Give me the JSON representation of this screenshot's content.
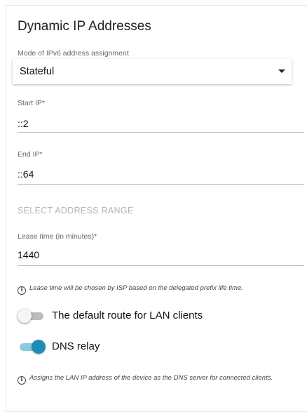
{
  "form": {
    "title": "Dynamic IP Addresses",
    "mode": {
      "label": "Mode of IPv6 address assignment",
      "value": "Stateful"
    },
    "start_ip": {
      "label": "Start IP",
      "required_mark": "*",
      "value": "::2"
    },
    "end_ip": {
      "label": "End IP",
      "required_mark": "*",
      "value": "::64"
    },
    "select_range": {
      "label": "SELECT ADDRESS RANGE"
    },
    "lease_time": {
      "label": "Lease time (in minutes)",
      "required_mark": "*",
      "value": "1440"
    },
    "lease_info": "Lease time will be chosen by ISP based on the delegated prefix life time.",
    "default_route": {
      "label": "The default route for LAN clients",
      "enabled": false
    },
    "dns_relay": {
      "label": "DNS relay",
      "enabled": true
    },
    "dns_info": "Assigns the LAN IP address of the device as the DNS server for connected clients.",
    "info_icon_glyph": "i"
  },
  "colors": {
    "accent": "#1f8cb8",
    "accent_track": "#8ec9dd",
    "required": "#e0303a",
    "section_heading": "#b5b5b5"
  },
  "icons": {
    "info": "info-circle-icon",
    "dropdown": "chevron-down-icon"
  }
}
